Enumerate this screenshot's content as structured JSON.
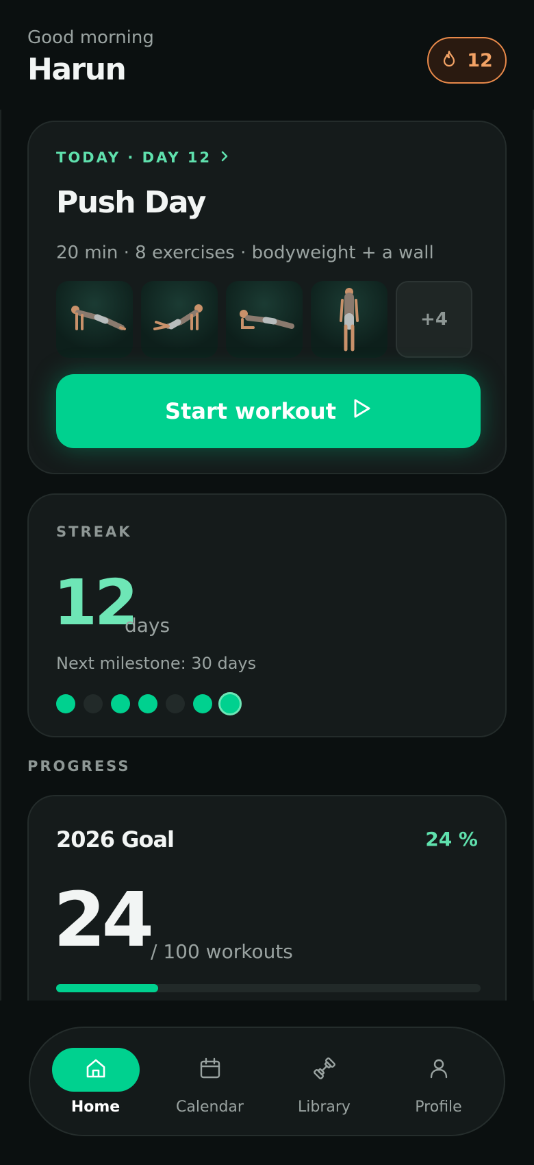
{
  "header": {
    "greeting": "Good morning",
    "name": "Harun",
    "streak_badge": {
      "icon": "flame-icon",
      "count": "12",
      "color": "#e8894a"
    }
  },
  "today": {
    "label": "TODAY · DAY 12",
    "title": "Push Day",
    "meta": "20 min · 8 exercises · bodyweight + a wall",
    "thumbnails": [
      "push-up",
      "knee push-up",
      "plank",
      "standing"
    ],
    "more_count": "+4",
    "start_button": "Start workout"
  },
  "streak": {
    "label": "STREAK",
    "count": "12",
    "unit": "days",
    "milestone": "Next milestone: 30 days",
    "days": [
      true,
      false,
      true,
      true,
      false,
      true,
      true
    ]
  },
  "progress": {
    "section_label": "PROGRESS",
    "goal_title": "2026 Goal",
    "goal_percent": "24 %",
    "done": "24",
    "total_text": "/ 100 workouts",
    "fraction": 0.24
  },
  "nav": {
    "items": [
      {
        "label": "Home",
        "icon": "home-icon",
        "active": true
      },
      {
        "label": "Calendar",
        "icon": "calendar-icon",
        "active": false
      },
      {
        "label": "Library",
        "icon": "dumbbell-icon",
        "active": false
      },
      {
        "label": "Profile",
        "icon": "user-icon",
        "active": false
      }
    ]
  },
  "colors": {
    "accent": "#00d18f",
    "accent_light": "#6ee6b6",
    "streak": "#e8894a",
    "background": "#0b1010",
    "card": "#151b1b"
  }
}
